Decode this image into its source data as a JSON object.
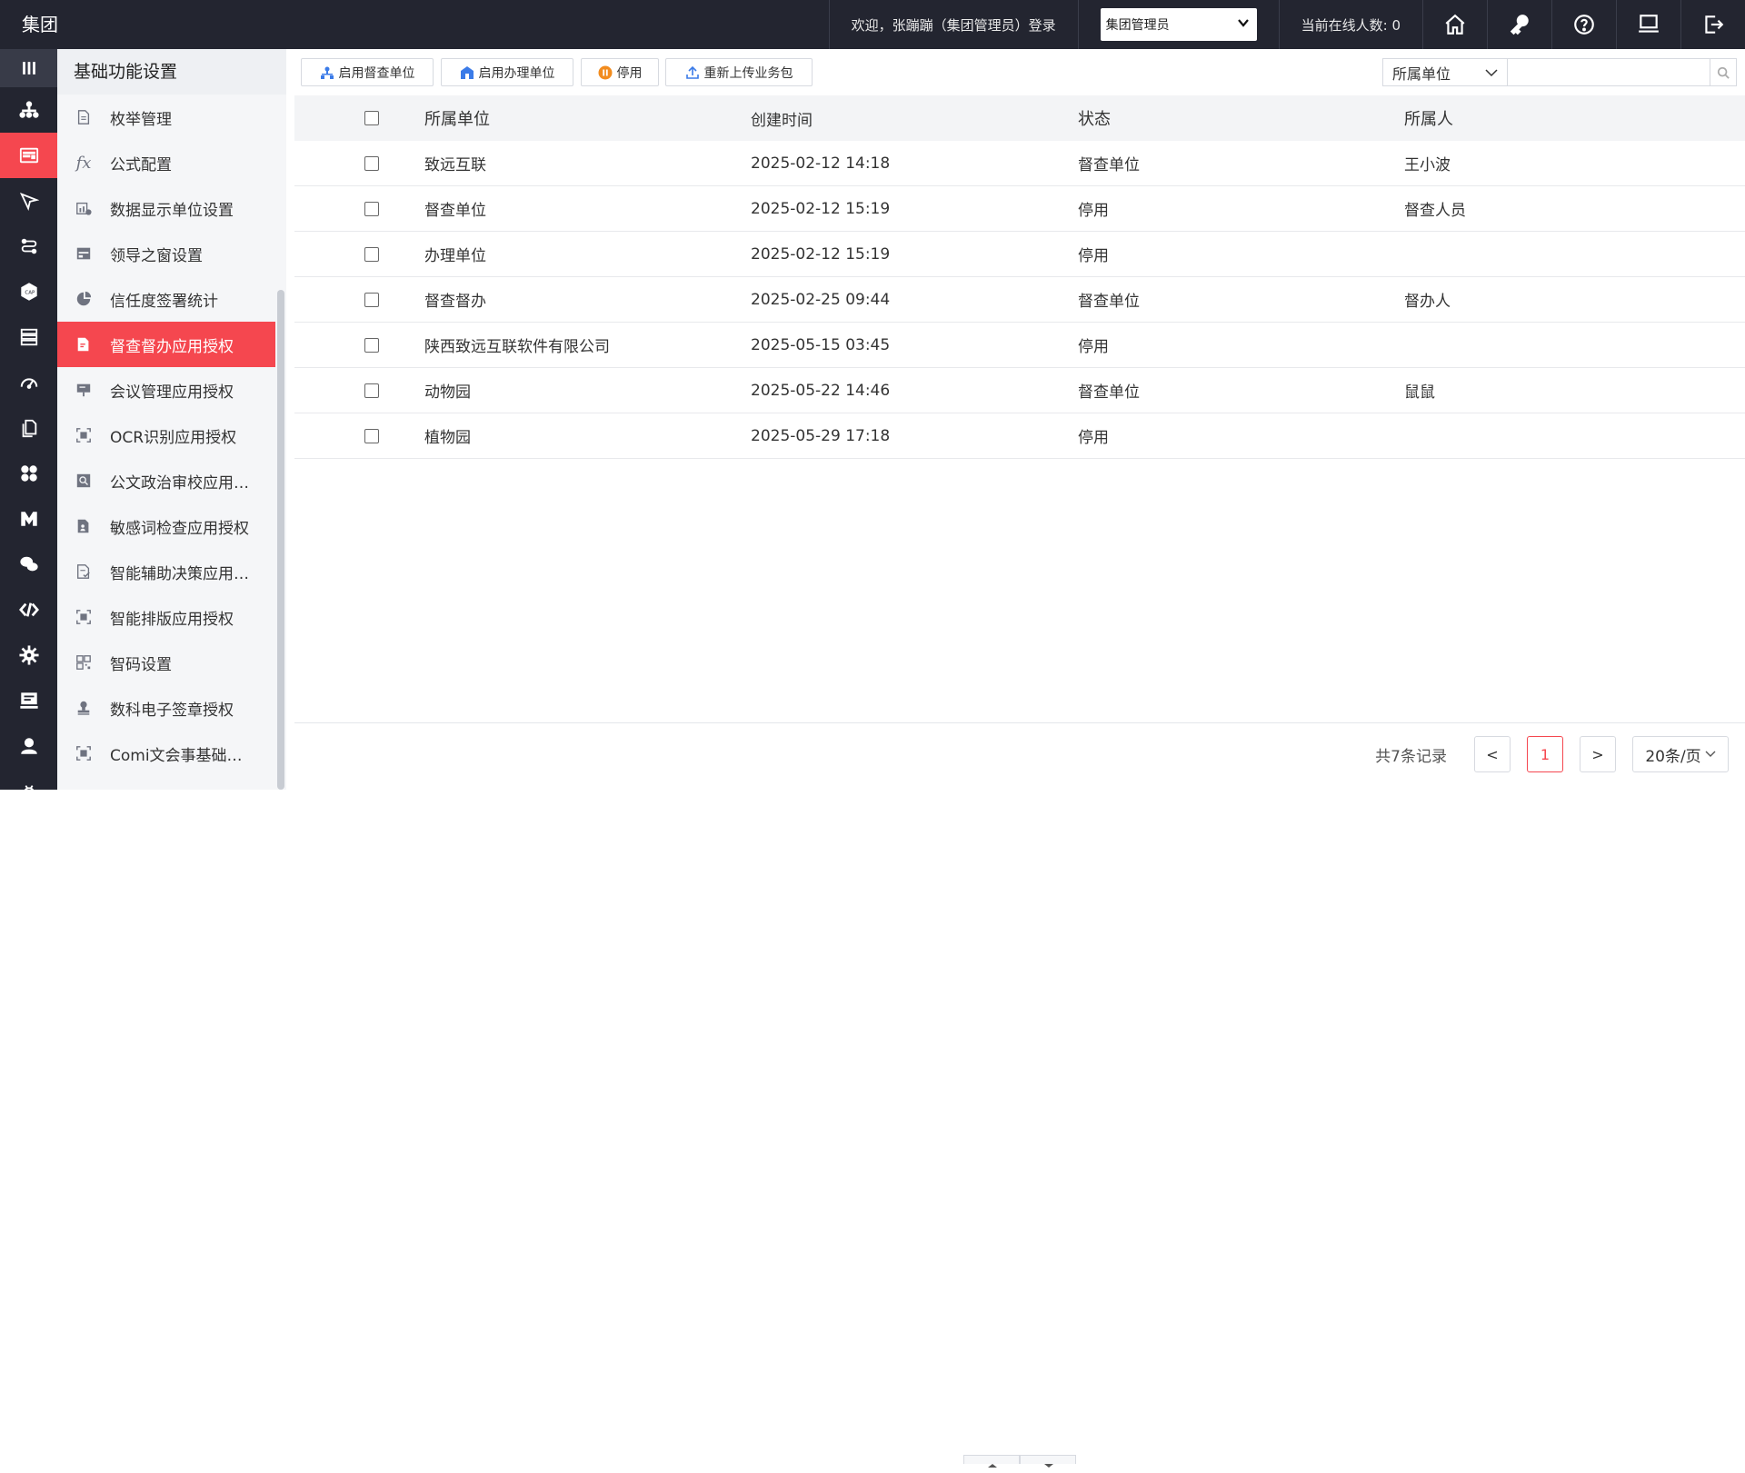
{
  "header": {
    "brand": "集团",
    "welcome": "欢迎，张蹦蹦（集团管理员）登录",
    "role_select": "集团管理员",
    "online_users": "当前在线人数: 0",
    "icons": [
      "home-icon",
      "key-icon",
      "help-icon",
      "monitor-icon",
      "logout-icon"
    ]
  },
  "rail": {
    "icons": [
      "menu-icon",
      "org-tree-icon",
      "form-icon",
      "pen-tool-icon",
      "route-icon",
      "cap-icon",
      "database-icon",
      "gauge-icon",
      "copy-icon",
      "apps-icon",
      "m-icon",
      "chat-icon",
      "code-icon",
      "settings-gear-icon",
      "monitor-icon",
      "user-icon",
      "bug-icon"
    ]
  },
  "sidebar": {
    "title": "基础功能设置",
    "items": [
      {
        "label": "枚举管理",
        "icon": "document-icon"
      },
      {
        "label": "公式配置",
        "icon": "fx-icon"
      },
      {
        "label": "数据显示单位设置",
        "icon": "chart-gear-icon"
      },
      {
        "label": "领导之窗设置",
        "icon": "window-icon"
      },
      {
        "label": "信任度签署统计",
        "icon": "pie-chart-icon"
      },
      {
        "label": "督查督办应用授权",
        "icon": "doc-edit-icon"
      },
      {
        "label": "会议管理应用授权",
        "icon": "presentation-icon"
      },
      {
        "label": "OCR识别应用授权",
        "icon": "scan-icon"
      },
      {
        "label": "公文政治审校应用…",
        "icon": "search-doc-icon"
      },
      {
        "label": "敏感词检查应用授权",
        "icon": "doc-person-icon"
      },
      {
        "label": "智能辅助决策应用…",
        "icon": "doc-check-icon"
      },
      {
        "label": "智能排版应用授权",
        "icon": "scan-icon"
      },
      {
        "label": "智码设置",
        "icon": "qrcode-icon"
      },
      {
        "label": "数科电子签章授权",
        "icon": "stamp-icon"
      },
      {
        "label": "Comi文会事基础…",
        "icon": "scan-icon"
      }
    ],
    "active_index": 5
  },
  "toolbar": {
    "buttons": [
      {
        "label": "启用督查单位",
        "icon": "org-icon"
      },
      {
        "label": "启用办理单位",
        "icon": "building-icon"
      },
      {
        "label": "停用",
        "icon": "pause-icon"
      },
      {
        "label": "重新上传业务包",
        "icon": "upload-icon"
      }
    ],
    "filter": "所属单位",
    "search_placeholder": ""
  },
  "table": {
    "columns": [
      "所属单位",
      "创建时间",
      "状态",
      "所属人"
    ],
    "rows": [
      {
        "unit": "致远互联",
        "time": "2025-02-12 14:18",
        "status": "督查单位",
        "owner": "王小波"
      },
      {
        "unit": "督查单位",
        "time": "2025-02-12 15:19",
        "status": "停用",
        "owner": "督查人员"
      },
      {
        "unit": "办理单位",
        "time": "2025-02-12 15:19",
        "status": "停用",
        "owner": ""
      },
      {
        "unit": "督查督办",
        "time": "2025-02-25 09:44",
        "status": "督查单位",
        "owner": "督办人"
      },
      {
        "unit": "陕西致远互联软件有限公司",
        "time": "2025-05-15 03:45",
        "status": "停用",
        "owner": ""
      },
      {
        "unit": "动物园",
        "time": "2025-05-22 14:46",
        "status": "督查单位",
        "owner": "鼠鼠"
      },
      {
        "unit": "植物园",
        "time": "2025-05-29 17:18",
        "status": "停用",
        "owner": ""
      }
    ]
  },
  "pager": {
    "total": "共7条记录",
    "prev": "<",
    "current": "1",
    "next": ">",
    "page_size": "20条/页"
  },
  "colors": {
    "topbar": "#232530",
    "accent": "#f5474f"
  }
}
